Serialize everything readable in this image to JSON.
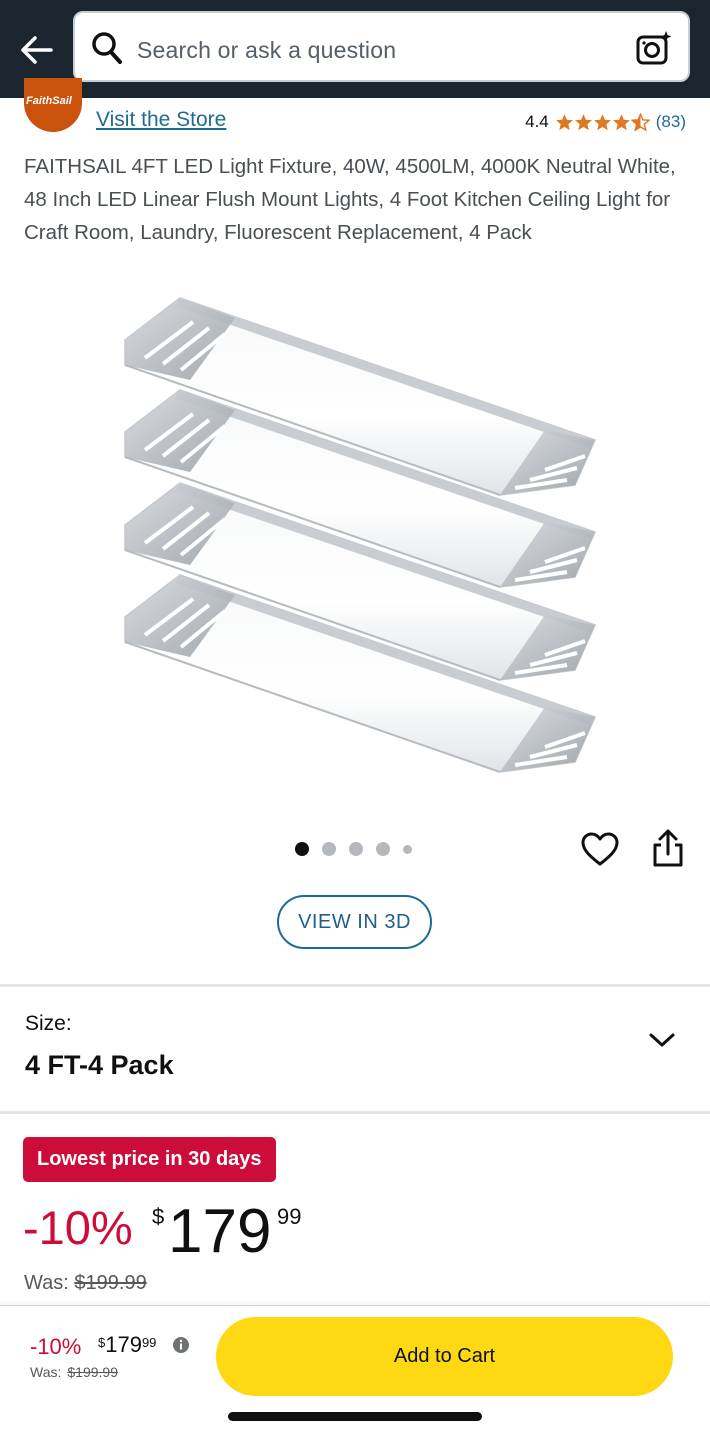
{
  "header": {
    "search_placeholder": "Search or ask a question"
  },
  "store": {
    "logo_text": "FaithSail",
    "visit_label": "Visit the Store",
    "rating": "4.4",
    "rating_stars": 4.4,
    "review_count": "(83)",
    "star_color": "#de7921"
  },
  "product": {
    "title": "FAITHSAIL 4FT LED Light Fixture, 40W, 4500LM, 4000K Neutral White, 48 Inch LED Linear Flush Mount Lights, 4 Foot Kitchen Ceiling Light for Craft Room, Laundry, Fluorescent Replacement, 4 Pack",
    "image_count": 5,
    "active_image": 1,
    "view_3d_label": "VIEW IN 3D"
  },
  "size": {
    "label": "Size:",
    "value": "4 FT-4 Pack"
  },
  "pricing": {
    "deal_badge": "Lowest price in 30 days",
    "discount": "-10%",
    "currency": "$",
    "price_whole": "179",
    "price_fraction": "99",
    "was_label": "Was:",
    "was_price": "$199.99"
  },
  "bottom_bar": {
    "discount": "-10%",
    "currency": "$",
    "price_whole": "179",
    "price_fraction": "99",
    "was_label": "Was:",
    "was_price": "$199.99",
    "add_to_cart_label": "Add to Cart"
  },
  "colors": {
    "header_bg": "#1b2530",
    "deal_red": "#cc0c39",
    "link_blue": "#1f6b96",
    "cart_yellow": "#ffd814"
  }
}
